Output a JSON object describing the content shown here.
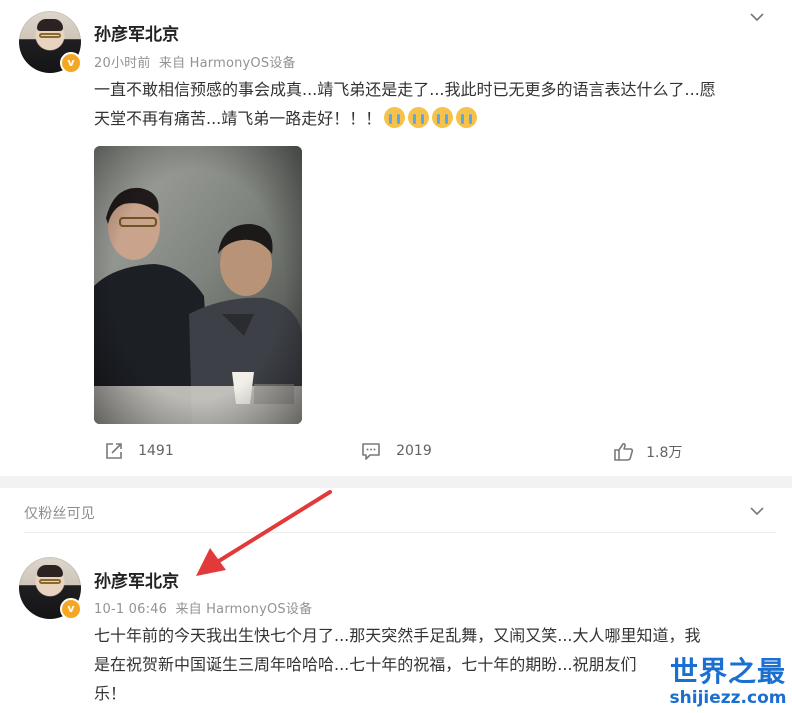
{
  "posts": [
    {
      "author": "孙彦军北京",
      "time": "20小时前",
      "source": "来自 HarmonyOS设备",
      "content_line1": "一直不敢相信预感的事会成真...靖飞弟还是走了...我此时已无更多的语言表达什么了...愿",
      "content_line2": "天堂不再有痛苦...靖飞弟一路走好！！！",
      "emoji_icon": "crying-emoji-icon",
      "emoji_count": 4,
      "repost_count": "1491",
      "comment_count": "2019",
      "like_count": "1.8万"
    },
    {
      "visibility_note": "仅粉丝可见",
      "author": "孙彦军北京",
      "time": "10-1 06:46",
      "source": "来自 HarmonyOS设备",
      "content_line1": "七十年前的今天我出生快七个月了...那天突然手足乱舞，又闹又笑...大人哪里知道，我",
      "content_line2": "是在祝贺新中国诞生三周年哈哈哈...七十年的祝福，七十年的期盼...祝朋友们",
      "content_line3": "乐！"
    }
  ],
  "watermark": {
    "title": "世界之最",
    "url": "shijiezz.com"
  },
  "colors": {
    "accent_arrow": "#e23a3a",
    "verified_badge": "#f5a623",
    "watermark": "#1a6fd1"
  }
}
